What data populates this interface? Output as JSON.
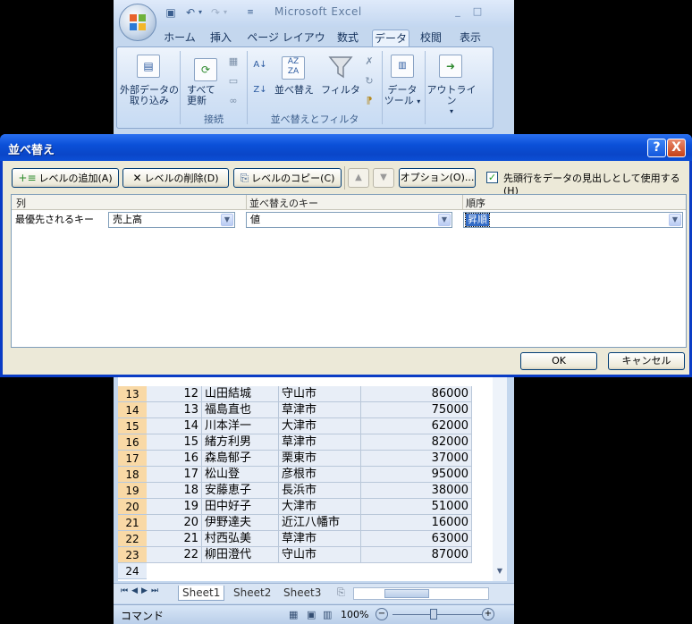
{
  "excel": {
    "app_title": "Microsoft Excel",
    "tabs": [
      "ホーム",
      "挿入",
      "ページ レイアウト",
      "数式",
      "データ",
      "校閲",
      "表示"
    ],
    "active_tab": "データ",
    "ribbon": {
      "external_data_label_1": "外部データの",
      "external_data_label_2": "取り込み",
      "refresh_label_1": "すべて",
      "refresh_label_2": "更新",
      "group_connections": "接続",
      "sort_label": "並べ替え",
      "filter_label": "フィルタ",
      "group_sort_filter": "並べ替えとフィルタ",
      "data_tools_label_1": "データ",
      "data_tools_label_2": "ツール",
      "outline_label": "アウトライン"
    },
    "rows": [
      {
        "row": "13",
        "no": "12",
        "name": "山田結城",
        "city": "守山市",
        "value": "86000"
      },
      {
        "row": "14",
        "no": "13",
        "name": "福島直也",
        "city": "草津市",
        "value": "75000"
      },
      {
        "row": "15",
        "no": "14",
        "name": "川本洋一",
        "city": "大津市",
        "value": "62000"
      },
      {
        "row": "16",
        "no": "15",
        "name": "緒方利男",
        "city": "草津市",
        "value": "82000"
      },
      {
        "row": "17",
        "no": "16",
        "name": "森島郁子",
        "city": "栗東市",
        "value": "37000"
      },
      {
        "row": "18",
        "no": "17",
        "name": "松山登",
        "city": "彦根市",
        "value": "95000"
      },
      {
        "row": "19",
        "no": "18",
        "name": "安藤恵子",
        "city": "長浜市",
        "value": "38000"
      },
      {
        "row": "20",
        "no": "19",
        "name": "田中好子",
        "city": "大津市",
        "value": "51000"
      },
      {
        "row": "21",
        "no": "20",
        "name": "伊野達夫",
        "city": "近江八幡市",
        "value": "16000"
      },
      {
        "row": "22",
        "no": "21",
        "name": "村西弘美",
        "city": "草津市",
        "value": "63000"
      },
      {
        "row": "23",
        "no": "22",
        "name": "柳田澄代",
        "city": "守山市",
        "value": "87000"
      }
    ],
    "empty_row": "24",
    "sheet_tabs": [
      "Sheet1",
      "Sheet2",
      "Sheet3"
    ],
    "status_mode": "コマンド",
    "zoom": "100%"
  },
  "dialog": {
    "title": "並べ替え",
    "help": "?",
    "close": "X",
    "add_level": "レベルの追加(A)",
    "delete_level": "レベルの削除(D)",
    "copy_level": "レベルのコピー(C)",
    "move_up": "▲",
    "move_down": "▼",
    "options": "オプション(O)...",
    "header_checkbox_label": "先頭行をデータの見出しとして使用する(H)",
    "header_checked": true,
    "columns": {
      "column": "列",
      "sort_on": "並べ替えのキー",
      "order": "順序"
    },
    "sort_row": {
      "key_label": "最優先されるキー",
      "column_value": "売上高",
      "sort_on_value": "値",
      "order_value": "昇順"
    },
    "ok": "OK",
    "cancel": "キャンセル"
  }
}
